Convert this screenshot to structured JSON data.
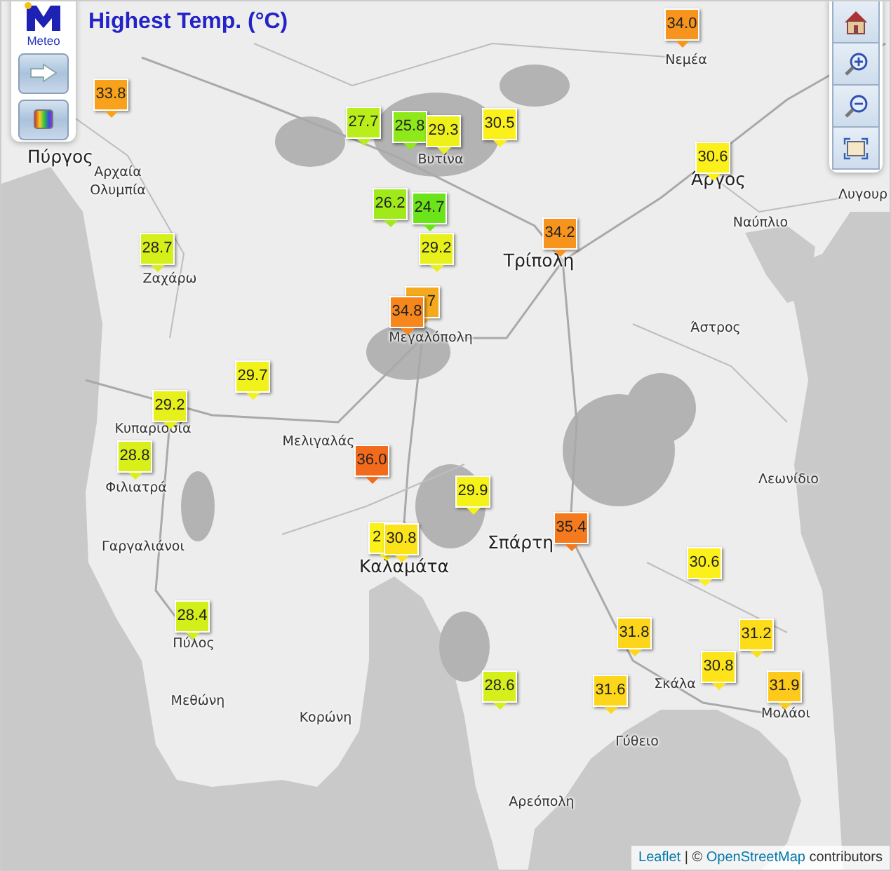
{
  "title": "Highest Temp. (°C)",
  "logo": {
    "text": "Meteo"
  },
  "markers": [
    {
      "value": "34.0",
      "color": "#f7941d"
    },
    {
      "value": "33.8",
      "color": "#f8a21c"
    },
    {
      "value": "27.7",
      "color": "#b9ee1b"
    },
    {
      "value": "25.8",
      "color": "#8ee81a"
    },
    {
      "value": "29.3",
      "color": "#eef01a"
    },
    {
      "value": "30.5",
      "color": "#fbf01a"
    },
    {
      "value": "30.6",
      "color": "#fbf01a"
    },
    {
      "value": "26.2",
      "color": "#a0ea1a"
    },
    {
      "value": "24.7",
      "color": "#6be51a"
    },
    {
      "value": "29.2",
      "color": "#e7f01a"
    },
    {
      "value": "34.2",
      "color": "#f7941d"
    },
    {
      "value": "28.7",
      "color": "#d5ef1a"
    },
    {
      "value": "7",
      "color": "#f5a91c"
    },
    {
      "value": "34.8",
      "color": "#f7871d"
    },
    {
      "value": "29.7",
      "color": "#f0f21a"
    },
    {
      "value": "29.2",
      "color": "#e7f01a"
    },
    {
      "value": "28.8",
      "color": "#d8ef1a"
    },
    {
      "value": "36.0",
      "color": "#f26a1c"
    },
    {
      "value": "29.9",
      "color": "#f5f21a"
    },
    {
      "value": "35.4",
      "color": "#f47a1d"
    },
    {
      "value": "2",
      "color": "#fbf01a"
    },
    {
      "value": "30.8",
      "color": "#fce21a"
    },
    {
      "value": "30.6",
      "color": "#fbf01a"
    },
    {
      "value": "28.4",
      "color": "#d2ef1a"
    },
    {
      "value": "31.8",
      "color": "#fdd51a"
    },
    {
      "value": "31.2",
      "color": "#fddc1a"
    },
    {
      "value": "30.8",
      "color": "#fde41a"
    },
    {
      "value": "28.6",
      "color": "#d5ef1a"
    },
    {
      "value": "31.6",
      "color": "#fdd51a"
    },
    {
      "value": "31.9",
      "color": "#fdc91a"
    }
  ],
  "places": [
    {
      "name": "Πύργος",
      "kind": "town"
    },
    {
      "name": "Αρχαία",
      "kind": "village"
    },
    {
      "name": "Ολυμπία",
      "kind": "village"
    },
    {
      "name": "Νεμέα",
      "kind": "village"
    },
    {
      "name": "Βυτίνα",
      "kind": "village"
    },
    {
      "name": "Άργος",
      "kind": "town"
    },
    {
      "name": "Λυγουρ",
      "kind": "village"
    },
    {
      "name": "Ναύπλιο",
      "kind": "village"
    },
    {
      "name": "Τρίπολη",
      "kind": "town"
    },
    {
      "name": "Ζαχάρω",
      "kind": "village"
    },
    {
      "name": "Άστρος",
      "kind": "village"
    },
    {
      "name": "Μεγαλόπολη",
      "kind": "village"
    },
    {
      "name": "Κυπαρισσία",
      "kind": "village"
    },
    {
      "name": "Μελιγαλάς",
      "kind": "village"
    },
    {
      "name": "Φιλιατρά",
      "kind": "village"
    },
    {
      "name": "Λεωνίδιο",
      "kind": "village"
    },
    {
      "name": "Γαργαλιάνοι",
      "kind": "village"
    },
    {
      "name": "Καλαμάτα",
      "kind": "town"
    },
    {
      "name": "Σπάρτη",
      "kind": "town"
    },
    {
      "name": "Πύλος",
      "kind": "village"
    },
    {
      "name": "Μεθώνη",
      "kind": "village"
    },
    {
      "name": "Κορώνη",
      "kind": "village"
    },
    {
      "name": "Σκάλα",
      "kind": "village"
    },
    {
      "name": "Μολάοι",
      "kind": "village"
    },
    {
      "name": "Γύθειο",
      "kind": "village"
    },
    {
      "name": "Αρεόπολη",
      "kind": "village"
    }
  ],
  "attribution": {
    "link_1": "Leaflet",
    "middle": " | © ",
    "link_2": "OpenStreetMap",
    "suffix": " contributors"
  }
}
